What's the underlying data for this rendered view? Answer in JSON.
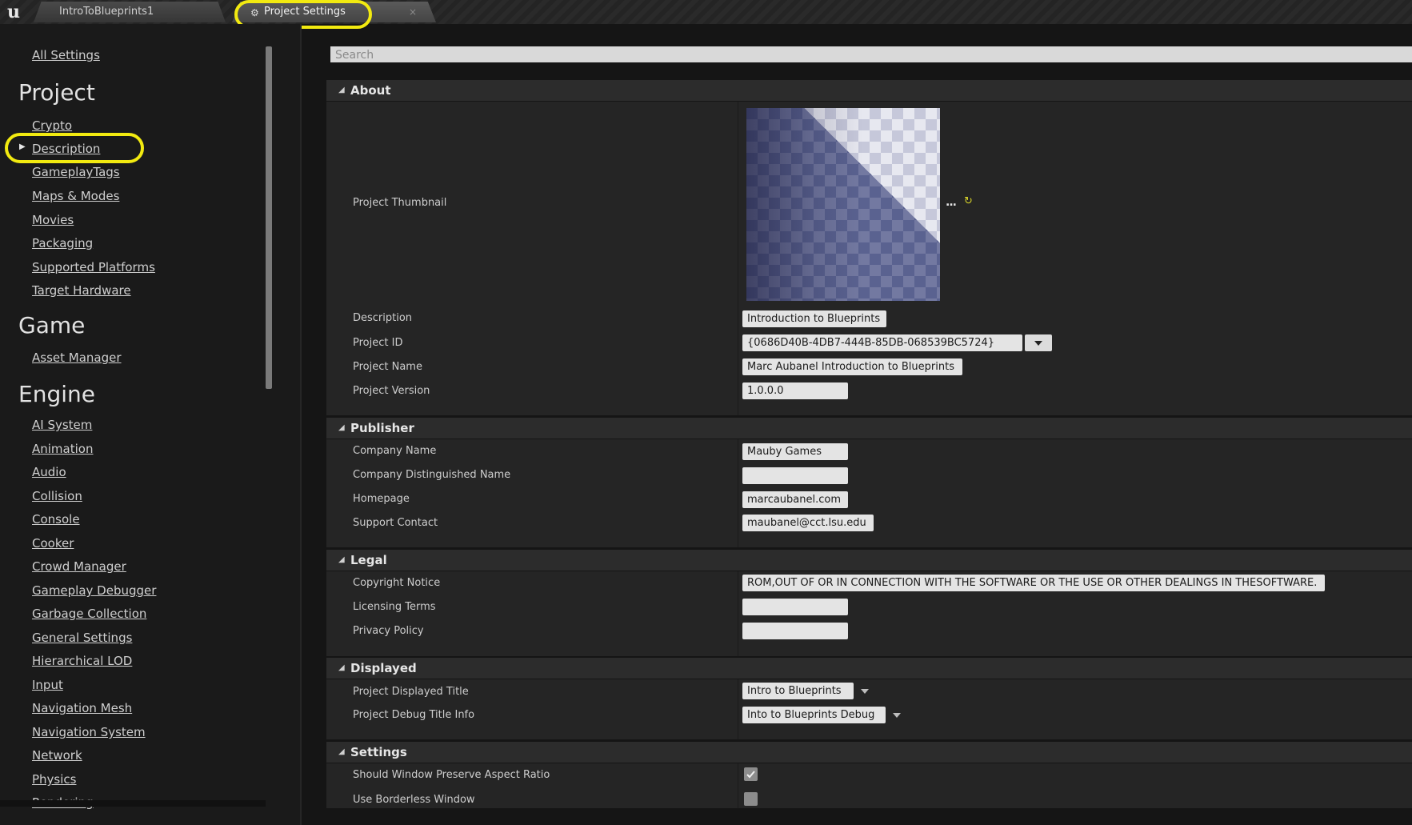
{
  "tabs": [
    {
      "label": "IntroToBlueprints1",
      "active": false
    },
    {
      "label": "Project Settings",
      "active": true
    }
  ],
  "sidebar": {
    "all_settings": "All Settings",
    "sections": [
      {
        "title": "Project",
        "items": [
          "Crypto",
          "Description",
          "GameplayTags",
          "Maps & Modes",
          "Movies",
          "Packaging",
          "Supported Platforms",
          "Target Hardware"
        ]
      },
      {
        "title": "Game",
        "items": [
          "Asset Manager"
        ]
      },
      {
        "title": "Engine",
        "items": [
          "AI System",
          "Animation",
          "Audio",
          "Collision",
          "Console",
          "Cooker",
          "Crowd Manager",
          "Gameplay Debugger",
          "Garbage Collection",
          "General Settings",
          "Hierarchical LOD",
          "Input",
          "Navigation Mesh",
          "Navigation System",
          "Network",
          "Physics",
          "Rendering"
        ]
      }
    ],
    "selected": "Description"
  },
  "search": {
    "placeholder": "Search",
    "value": ""
  },
  "about": {
    "title": "About",
    "thumbnail_label": "Project Thumbnail",
    "thumbnail_more": "...",
    "thumbnail_reset": "↻",
    "description_label": "Description",
    "description_value": "Introduction to Blueprints",
    "project_id_label": "Project ID",
    "project_id_value": "{0686D40B-4DB7-444B-85DB-068539BC5724}",
    "project_name_label": "Project Name",
    "project_name_value": "Marc Aubanel Introduction to Blueprints",
    "project_version_label": "Project Version",
    "project_version_value": "1.0.0.0"
  },
  "publisher": {
    "title": "Publisher",
    "company_name_label": "Company Name",
    "company_name_value": "Mauby Games",
    "company_dn_label": "Company Distinguished Name",
    "company_dn_value": "",
    "homepage_label": "Homepage",
    "homepage_value": "marcaubanel.com",
    "support_label": "Support Contact",
    "support_value": "maubanel@cct.lsu.edu"
  },
  "legal": {
    "title": "Legal",
    "copyright_label": "Copyright Notice",
    "copyright_value": "ROM,OUT OF OR IN CONNECTION WITH THE SOFTWARE OR THE USE OR OTHER DEALINGS IN THESOFTWARE.",
    "licensing_label": "Licensing Terms",
    "licensing_value": "",
    "privacy_label": "Privacy Policy",
    "privacy_value": ""
  },
  "displayed": {
    "title": "Displayed",
    "displayed_title_label": "Project Displayed Title",
    "displayed_title_value": "Intro to Blueprints",
    "debug_title_label": "Project Debug Title Info",
    "debug_title_value": "Into to Blueprints Debug"
  },
  "settings": {
    "title": "Settings",
    "aspect_label": "Should Window Preserve Aspect Ratio",
    "aspect_checked": true,
    "borderless_label": "Use Borderless Window",
    "borderless_checked": false
  },
  "colors": {
    "highlight": "#f2ea10",
    "field_bg": "#e4e4e4",
    "panel_bg": "#252525",
    "section_header_bg": "#2c2c2c"
  }
}
